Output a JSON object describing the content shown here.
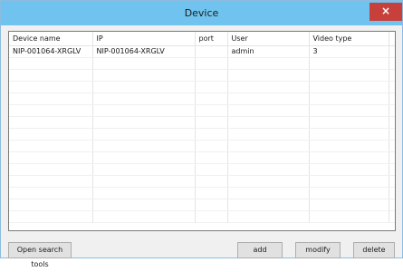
{
  "window": {
    "title": "Device",
    "close_label": "×"
  },
  "table": {
    "columns": [
      "Device name",
      "IP",
      "port",
      "User",
      "Video type",
      ""
    ],
    "rows": [
      [
        "NIP-001064-XRGLV",
        "NIP-001064-XRGLV",
        "",
        "admin",
        "3",
        ""
      ]
    ]
  },
  "buttons": {
    "open_search_tools": "Open search tools",
    "add": "add",
    "modify": "modify",
    "delete": "delete"
  }
}
